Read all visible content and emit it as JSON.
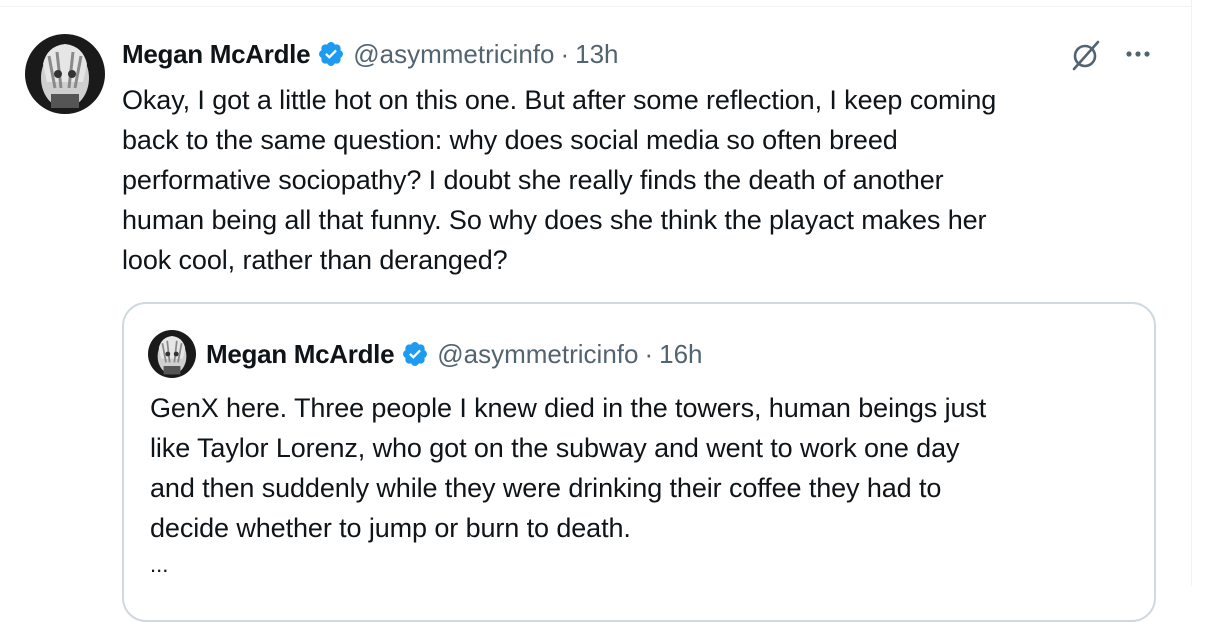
{
  "tweet": {
    "author_name": "Megan McArdle",
    "handle": "@asymmetricinfo",
    "separator": "·",
    "time": "13h",
    "text_lines": [
      "Okay, I got a little hot on this one. But after some reflection, I keep coming",
      "back to the same question: why does social media so often breed",
      "performative sociopathy? I doubt she really finds the death of another",
      "human being all that funny. So why does she think the playact makes her",
      "look cool, rather than deranged?"
    ]
  },
  "quoted_tweet": {
    "author_name": "Megan McArdle",
    "handle": "@asymmetricinfo",
    "separator": "·",
    "time": "16h",
    "text_lines": [
      "GenX here. Three people I knew died in the towers, human beings just",
      "like Taylor Lorenz, who got on the subway and went to work one day",
      "and then suddenly while they were drinking their coffee they had to",
      "decide whether to jump or burn to death."
    ],
    "truncation": "..."
  },
  "icons": {
    "verified": "verified-badge-icon",
    "grok": "grok-icon",
    "more": "more-options-icon"
  },
  "colors": {
    "verified_blue": "#1d9bf0",
    "secondary_text": "#536471",
    "border": "#cfd9de"
  }
}
